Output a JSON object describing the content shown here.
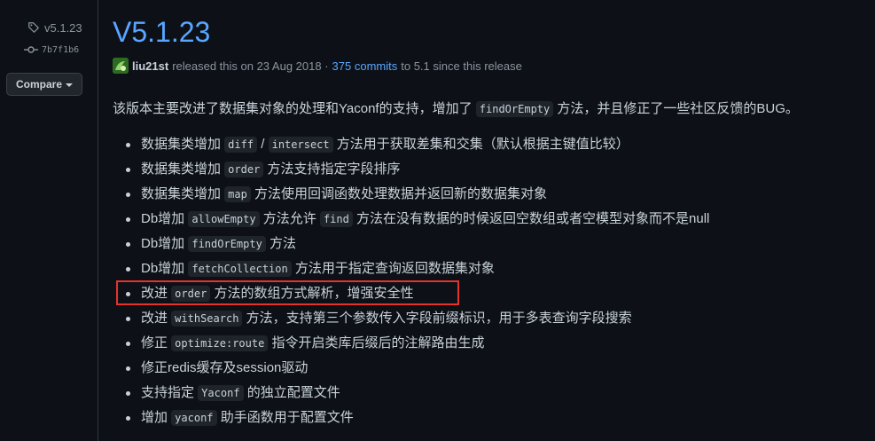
{
  "sidebar": {
    "tag": "v5.1.23",
    "commit": "7b7f1b6",
    "compare_label": "Compare"
  },
  "release": {
    "title": "V5.1.23",
    "author": "liu21st",
    "released_text": "released this on 23 Aug 2018 ·",
    "commits_link": "375 commits",
    "to_text": "to 5.1 since this release",
    "intro": {
      "before": "该版本主要改进了数据集对象的处理和Yaconf的支持，增加了",
      "code": "findOrEmpty",
      "after": "方法，并且修正了一些社区反馈的BUG。"
    },
    "changes": [
      [
        "数据集类增加 ",
        {
          "c": "diff"
        },
        " / ",
        {
          "c": "intersect"
        },
        " 方法用于获取差集和交集（默认根据主键值比较）"
      ],
      [
        "数据集类增加 ",
        {
          "c": "order"
        },
        " 方法支持指定字段排序"
      ],
      [
        "数据集类增加 ",
        {
          "c": "map"
        },
        " 方法使用回调函数处理数据并返回新的数据集对象"
      ],
      [
        "Db增加 ",
        {
          "c": "allowEmpty"
        },
        " 方法允许 ",
        {
          "c": "find"
        },
        " 方法在没有数据的时候返回空数组或者空模型对象而不是null"
      ],
      [
        "Db增加 ",
        {
          "c": "findOrEmpty"
        },
        " 方法"
      ],
      [
        "Db增加 ",
        {
          "c": "fetchCollection"
        },
        " 方法用于指定查询返回数据集对象"
      ],
      [
        "改进 ",
        {
          "c": "order"
        },
        " 方法的数组方式解析，增强安全性"
      ],
      [
        "改进 ",
        {
          "c": "withSearch"
        },
        " 方法，支持第三个参数传入字段前缀标识，用于多表查询字段搜索"
      ],
      [
        "修正 ",
        {
          "c": "optimize:route"
        },
        " 指令开启类库后缀后的注解路由生成"
      ],
      [
        "修正redis缓存及session驱动"
      ],
      [
        "支持指定 ",
        {
          "c": "Yaconf"
        },
        " 的独立配置文件"
      ],
      [
        "增加 ",
        {
          "c": "yaconf"
        },
        " 助手函数用于配置文件"
      ]
    ],
    "highlighted_index": 6
  }
}
